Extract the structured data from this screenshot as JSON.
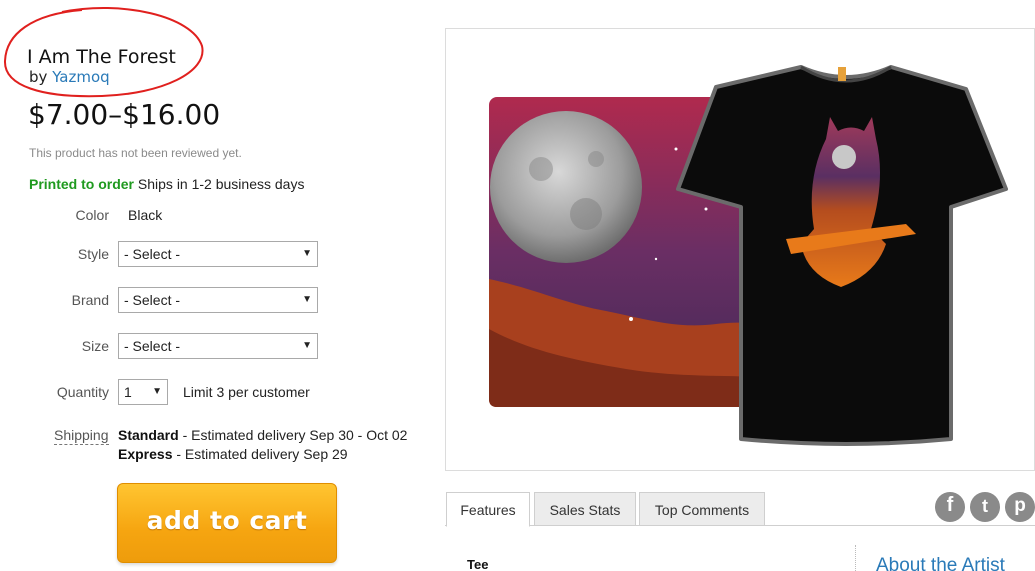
{
  "product": {
    "title": "I Am The Forest",
    "by_prefix": "by",
    "artist": "Yazmoq",
    "price": "$7.00–$16.00",
    "review_note": "This product has not been reviewed yet.",
    "stock_status": "Printed to order",
    "ship_time": "Ships in 1-2 business days"
  },
  "options": {
    "color_label": "Color",
    "color_value": "Black",
    "style_label": "Style",
    "style_value": "- Select -",
    "brand_label": "Brand",
    "brand_value": "- Select -",
    "size_label": "Size",
    "size_value": "- Select -",
    "quantity_label": "Quantity",
    "quantity_value": "1",
    "quantity_limit": "Limit 3 per customer"
  },
  "shipping": {
    "label": "Shipping",
    "standard_name": "Standard",
    "standard_text": " - Estimated delivery Sep 30 - Oct 02",
    "express_name": "Express",
    "express_text": " - Estimated delivery Sep 29"
  },
  "cart_button": "add to cart",
  "tabs": [
    "Features",
    "Sales Stats",
    "Top Comments"
  ],
  "social": {
    "facebook": "f",
    "twitter": "t",
    "pinterest": "p"
  },
  "details": {
    "tee_label": "Tee",
    "about_artist": "About the Artist"
  },
  "colors": {
    "link": "#2a7ab8",
    "in_stock": "#1f9a1f",
    "cart_button": "#f6a510",
    "annotation_circle": "#e0201e"
  },
  "icons": [
    "select-arrow-icon",
    "facebook-icon",
    "twitter-icon",
    "pinterest-icon"
  ]
}
